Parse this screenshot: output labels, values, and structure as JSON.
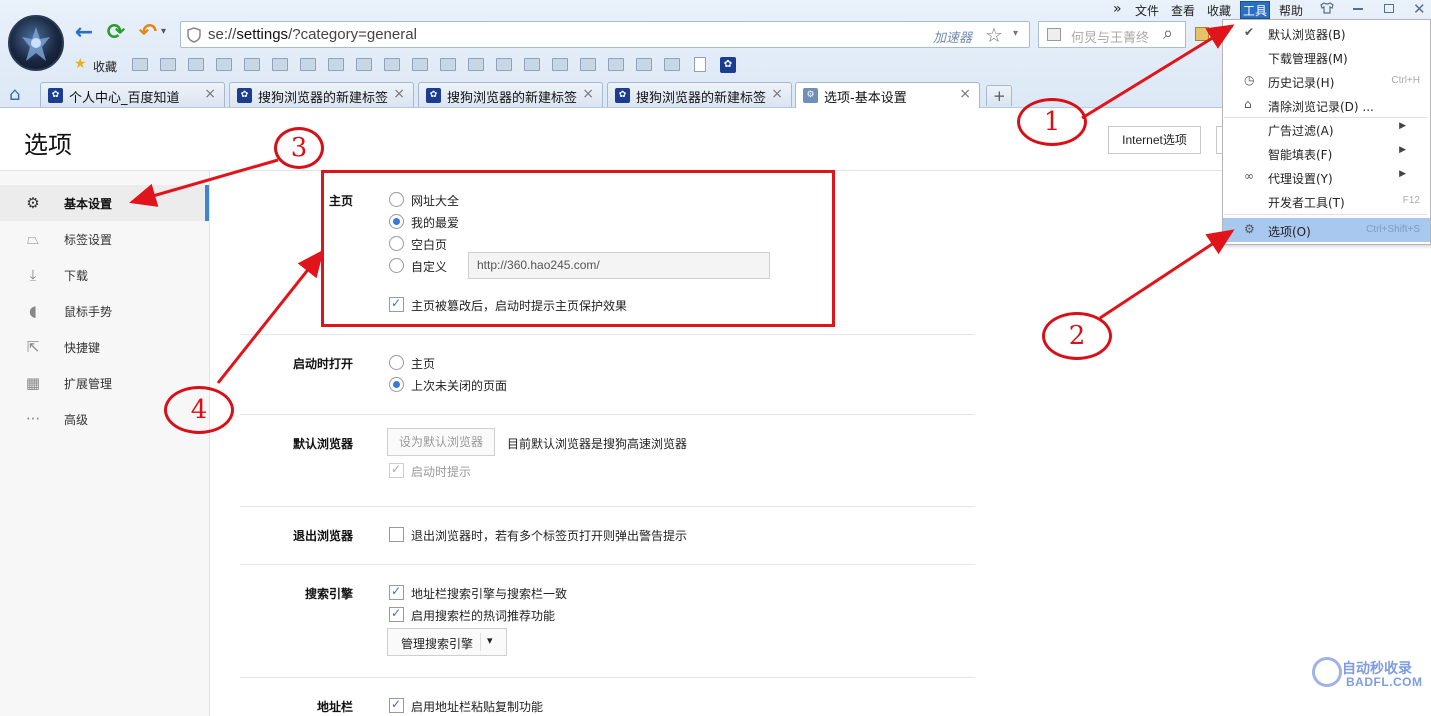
{
  "menubar": {
    "overflow": "»",
    "items": [
      "文件",
      "查看",
      "收藏",
      "工具",
      "帮助"
    ],
    "window_controls": [
      "skin-icon",
      "minimize-icon",
      "restore-icon",
      "close-icon"
    ]
  },
  "toolbar": {
    "back": "←",
    "refresh": "⟳",
    "undo": "↶",
    "undo_drop": "▾",
    "address_prefix": "se://",
    "address_main": "settings",
    "address_suffix": "/?category=general",
    "accelerator": "加速器",
    "star": "☆",
    "dropdown": "▾",
    "search_placeholder": "何炅与王菁终",
    "search_icon": "⌕"
  },
  "favbar": {
    "label": "收藏",
    "star": "★"
  },
  "tabs": [
    {
      "title": "个人中心_百度知道",
      "active": false
    },
    {
      "title": "搜狗浏览器的新建标签页",
      "active": false
    },
    {
      "title": "搜狗浏览器的新建标签页",
      "active": false
    },
    {
      "title": "搜狗浏览器的新建标签页",
      "active": false
    },
    {
      "title": "选项-基本设置",
      "active": true
    }
  ],
  "tab_close": "×",
  "tab_add": "+",
  "home_icon": "⌂",
  "page": {
    "title": "选项",
    "ie_options_button": "Internet选项"
  },
  "sidebar": {
    "items": [
      {
        "label": "基本设置",
        "icon": "⚙",
        "active": true
      },
      {
        "label": "标签设置",
        "icon": "⏢",
        "active": false
      },
      {
        "label": "下载",
        "icon": "⤓",
        "active": false
      },
      {
        "label": "鼠标手势",
        "icon": "◖",
        "active": false
      },
      {
        "label": "快捷键",
        "icon": "⇱",
        "active": false
      },
      {
        "label": "扩展管理",
        "icon": "▦",
        "active": false
      },
      {
        "label": "高级",
        "icon": "···",
        "active": false
      }
    ]
  },
  "sections": {
    "homepage": {
      "label": "主页",
      "options": [
        "网址大全",
        "我的最爱",
        "空白页",
        "自定义"
      ],
      "selected": "我的最爱",
      "custom_url": "http://360.hao245.com/",
      "protect_label": "主页被篡改后，启动时提示主页保护效果",
      "protect_checked": true
    },
    "startup": {
      "label": "启动时打开",
      "options": [
        "主页",
        "上次未关闭的页面"
      ],
      "selected": "上次未关闭的页面"
    },
    "default_browser": {
      "label": "默认浏览器",
      "button": "设为默认浏览器",
      "status": "目前默认浏览器是搜狗高速浏览器",
      "prompt_label": "启动时提示",
      "prompt_checked": true
    },
    "exit": {
      "label": "退出浏览器",
      "option": "退出浏览器时，若有多个标签页打开则弹出警告提示",
      "checked": false
    },
    "search": {
      "label": "搜索引擎",
      "options": [
        "地址栏搜索引擎与搜索栏一致",
        "启用搜索栏的热词推荐功能"
      ],
      "manage_button": "管理搜索引擎",
      "manage_arrow": "▾"
    },
    "addressbar": {
      "label": "地址栏",
      "option": "启用地址栏粘贴复制功能"
    }
  },
  "tools_menu": {
    "items": [
      {
        "label": "默认浏览器(B)",
        "icon": "✔",
        "shortcut": "",
        "arrow": ""
      },
      {
        "label": "下载管理器(M)",
        "icon": "",
        "shortcut": "",
        "arrow": ""
      },
      {
        "label": "历史记录(H)",
        "icon": "◷",
        "shortcut": "Ctrl+H",
        "arrow": ""
      },
      {
        "label": "清除浏览记录(D) ...",
        "icon": "⌂",
        "shortcut": "",
        "arrow": ""
      },
      {
        "label": "广告过滤(A)",
        "icon": "",
        "shortcut": "",
        "arrow": "▶"
      },
      {
        "label": "智能填表(F)",
        "icon": "",
        "shortcut": "",
        "arrow": "▶"
      },
      {
        "label": "代理设置(Y)",
        "icon": "∞",
        "shortcut": "",
        "arrow": "▶"
      },
      {
        "label": "开发者工具(T)",
        "icon": "",
        "shortcut": "F12",
        "arrow": ""
      },
      {
        "label": "选项(O)",
        "icon": "⚙",
        "shortcut": "Ctrl+Shift+S",
        "arrow": ""
      }
    ]
  },
  "annotations": [
    "1",
    "2",
    "3",
    "4"
  ],
  "watermark": {
    "line1": "自动秒收录",
    "line2": "BADFL.COM"
  },
  "colors": {
    "accent": "#3e84cf",
    "annotation_red": "#e0141b",
    "menu_highlight": "#a9c8ef"
  }
}
